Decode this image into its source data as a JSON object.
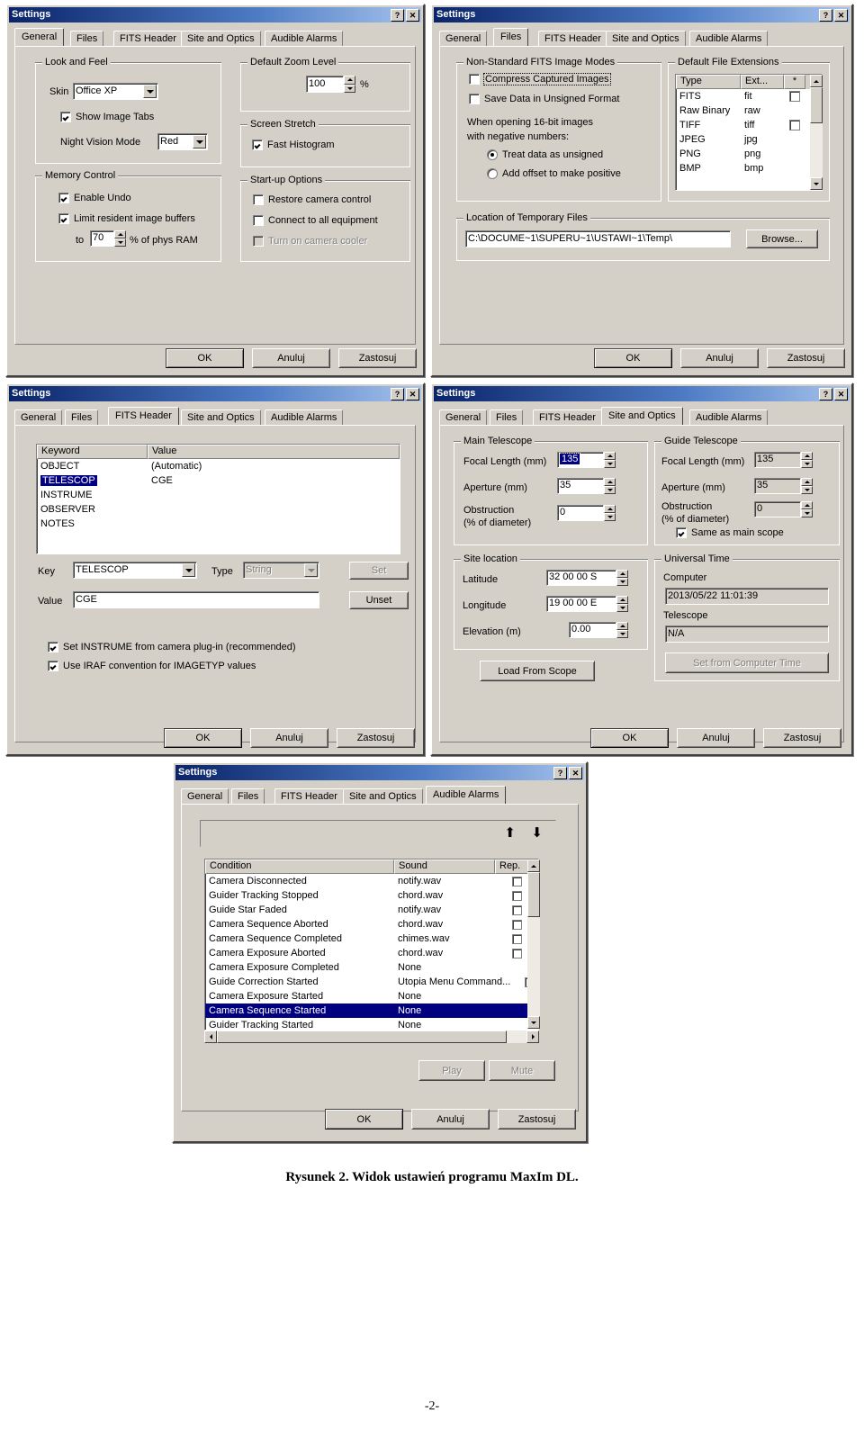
{
  "document": {
    "caption": "Rysunek 2. Widok ustawień programu MaxIm DL.",
    "page_number": "-2-"
  },
  "common": {
    "window_title": "Settings",
    "help_button": "?",
    "close_button": "✕",
    "tabs": [
      "General",
      "Files",
      "FITS Header",
      "Site and Optics",
      "Audible Alarms"
    ],
    "ok": "OK",
    "cancel": "Anuluj",
    "apply": "Zastosuj"
  },
  "dialog_general": {
    "active_tab": "General",
    "look_and_feel": {
      "title": "Look and Feel",
      "skin_label": "Skin",
      "skin_value": "Office XP",
      "show_image_tabs": "Show Image Tabs",
      "show_image_tabs_checked": true,
      "night_vision_label": "Night Vision Mode",
      "night_vision_value": "Red"
    },
    "memory_control": {
      "title": "Memory Control",
      "enable_undo": "Enable Undo",
      "enable_undo_checked": true,
      "limit_buffers": "Limit resident image buffers",
      "limit_buffers_checked": true,
      "to_label": "to",
      "percent_value": "70",
      "percent_suffix": "% of phys RAM"
    },
    "default_zoom": {
      "title": "Default Zoom Level",
      "value": "100",
      "unit": "%"
    },
    "screen_stretch": {
      "title": "Screen Stretch",
      "fast_histogram": "Fast Histogram",
      "fast_histogram_checked": true
    },
    "startup_options": {
      "title": "Start-up Options",
      "restore_camera_control": "Restore camera control",
      "connect_all_equipment": "Connect to all equipment",
      "turn_on_cooler": "Turn on camera cooler"
    }
  },
  "dialog_files": {
    "active_tab": "Files",
    "fits_modes": {
      "title": "Non-Standard FITS Image Modes",
      "compress": "Compress Captured Images",
      "save_unsigned": "Save Data in Unsigned Format",
      "note_line1": "When opening 16-bit images",
      "note_line2": "with negative numbers:",
      "radio_unsigned": "Treat data as unsigned",
      "radio_offset": "Add offset to make positive",
      "selected_radio": "unsigned"
    },
    "extensions": {
      "title": "Default File Extensions",
      "columns": [
        "Type",
        "Ext...",
        "*"
      ],
      "rows": [
        {
          "type": "FITS",
          "ext": "fit",
          "star": "checked"
        },
        {
          "type": "Raw Binary",
          "ext": "raw",
          "star": "none"
        },
        {
          "type": "TIFF",
          "ext": "tiff",
          "star": "unchecked"
        },
        {
          "type": "JPEG",
          "ext": "jpg",
          "star": "none"
        },
        {
          "type": "PNG",
          "ext": "png",
          "star": "none"
        },
        {
          "type": "BMP",
          "ext": "bmp",
          "star": "none"
        }
      ]
    },
    "temp_files": {
      "title": "Location of Temporary Files",
      "path": "C:\\DOCUME~1\\SUPERU~1\\USTAWI~1\\Temp\\",
      "browse": "Browse..."
    }
  },
  "dialog_fits_header": {
    "active_tab": "FITS Header",
    "list": {
      "columns": [
        "Keyword",
        "Value"
      ],
      "rows": [
        {
          "keyword": "OBJECT",
          "value": "(Automatic)",
          "selected": false
        },
        {
          "keyword": "TELESCOP",
          "value": "CGE",
          "selected": true
        },
        {
          "keyword": "INSTRUME",
          "value": "",
          "selected": false
        },
        {
          "keyword": "OBSERVER",
          "value": "",
          "selected": false
        },
        {
          "keyword": "NOTES",
          "value": "",
          "selected": false
        }
      ]
    },
    "key_label": "Key",
    "key_value": "TELESCOP",
    "type_label": "Type",
    "type_value": "String",
    "set_button": "Set",
    "value_label": "Value",
    "value_value": "CGE",
    "unset_button": "Unset",
    "cb_instrume": "Set INSTRUME from camera plug-in (recommended)",
    "cb_instrume_checked": true,
    "cb_iraf": "Use IRAF convention for IMAGETYP values",
    "cb_iraf_checked": true
  },
  "dialog_site_optics": {
    "active_tab": "Site and Optics",
    "main_telescope": {
      "title": "Main Telescope",
      "focal_length_label": "Focal Length (mm)",
      "focal_length_value": "135",
      "aperture_label": "Aperture (mm)",
      "aperture_value": "35",
      "obstruction_label_1": "Obstruction",
      "obstruction_label_2": "(% of diameter)",
      "obstruction_value": "0"
    },
    "guide_telescope": {
      "title": "Guide Telescope",
      "focal_length_label": "Focal Length (mm)",
      "focal_length_value": "135",
      "aperture_label": "Aperture (mm)",
      "aperture_value": "35",
      "obstruction_label_1": "Obstruction",
      "obstruction_label_2": "(% of diameter)",
      "obstruction_value": "0",
      "same_as_main": "Same as main scope",
      "same_as_main_checked": true
    },
    "site_location": {
      "title": "Site location",
      "latitude_label": "Latitude",
      "latitude_value": "32 00 00 S",
      "longitude_label": "Longitude",
      "longitude_value": "19 00 00 E",
      "elevation_label": "Elevation (m)",
      "elevation_value": "0.00",
      "load_from_scope": "Load From Scope"
    },
    "universal_time": {
      "title": "Universal Time",
      "computer_label": "Computer",
      "computer_value": "2013/05/22 11:01:39",
      "telescope_label": "Telescope",
      "telescope_value": "N/A",
      "set_from_computer": "Set from Computer Time"
    }
  },
  "dialog_audible_alarms": {
    "active_tab": "Audible Alarms",
    "move_up_icon": "arrow-up",
    "move_down_icon": "arrow-down",
    "columns": [
      "Condition",
      "Sound",
      "Rep."
    ],
    "rows": [
      {
        "condition": "Camera Disconnected",
        "sound": "notify.wav",
        "rep": "unchecked",
        "selected": false
      },
      {
        "condition": "Guider Tracking Stopped",
        "sound": "chord.wav",
        "rep": "unchecked",
        "selected": false
      },
      {
        "condition": "Guide Star Faded",
        "sound": "notify.wav",
        "rep": "unchecked",
        "selected": false
      },
      {
        "condition": "Camera Sequence Aborted",
        "sound": "chord.wav",
        "rep": "unchecked",
        "selected": false
      },
      {
        "condition": "Camera Sequence Completed",
        "sound": "chimes.wav",
        "rep": "unchecked",
        "selected": false
      },
      {
        "condition": "Camera Exposure Aborted",
        "sound": "chord.wav",
        "rep": "unchecked",
        "selected": false
      },
      {
        "condition": "Camera Exposure Completed",
        "sound": "None",
        "rep": "none",
        "selected": false
      },
      {
        "condition": "Guide Correction Started",
        "sound": "Utopia Menu Command...",
        "rep": "unchecked",
        "selected": false
      },
      {
        "condition": "Camera Exposure Started",
        "sound": "None",
        "rep": "none",
        "selected": false
      },
      {
        "condition": "Camera Sequence Started",
        "sound": "None",
        "rep": "none",
        "selected": true
      },
      {
        "condition": "Guider Tracking Started",
        "sound": "None",
        "rep": "none",
        "selected": false
      }
    ],
    "play_button": "Play",
    "mute_button": "Mute"
  }
}
